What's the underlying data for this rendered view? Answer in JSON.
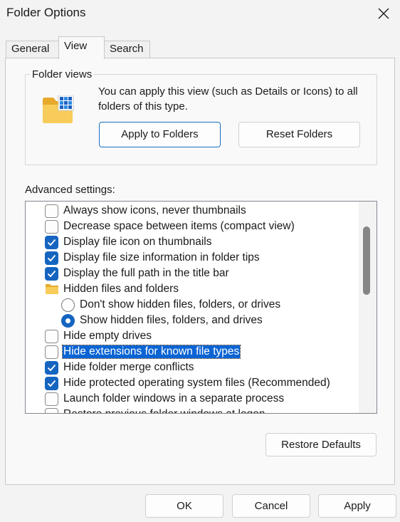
{
  "window": {
    "title": "Folder Options"
  },
  "tabs": [
    {
      "label": "General",
      "active": false
    },
    {
      "label": "View",
      "active": true
    },
    {
      "label": "Search",
      "active": false
    }
  ],
  "folder_views": {
    "legend": "Folder views",
    "description": "You can apply this view (such as Details or Icons) to all folders of this type.",
    "apply_button": "Apply to Folders",
    "reset_button": "Reset Folders"
  },
  "advanced": {
    "label": "Advanced settings:",
    "items": [
      {
        "type": "checkbox",
        "checked": false,
        "label": "Always show icons, never thumbnails"
      },
      {
        "type": "checkbox",
        "checked": false,
        "label": "Decrease space between items (compact view)"
      },
      {
        "type": "checkbox",
        "checked": true,
        "label": "Display file icon on thumbnails"
      },
      {
        "type": "checkbox",
        "checked": true,
        "label": "Display file size information in folder tips"
      },
      {
        "type": "checkbox",
        "checked": true,
        "label": "Display the full path in the title bar"
      },
      {
        "type": "folder",
        "label": "Hidden files and folders"
      },
      {
        "type": "radio",
        "checked": false,
        "label": "Don't show hidden files, folders, or drives"
      },
      {
        "type": "radio",
        "checked": true,
        "label": "Show hidden files, folders, and drives"
      },
      {
        "type": "checkbox",
        "checked": false,
        "label": "Hide empty drives"
      },
      {
        "type": "checkbox",
        "checked": false,
        "selected": true,
        "label": "Hide extensions for known file types"
      },
      {
        "type": "checkbox",
        "checked": true,
        "label": "Hide folder merge conflicts"
      },
      {
        "type": "checkbox",
        "checked": true,
        "label": "Hide protected operating system files (Recommended)"
      },
      {
        "type": "checkbox",
        "checked": false,
        "label": "Launch folder windows in a separate process"
      },
      {
        "type": "checkbox",
        "checked": false,
        "label": "Restore previous folder windows at logon"
      }
    ],
    "restore_button": "Restore Defaults"
  },
  "footer": {
    "ok": "OK",
    "cancel": "Cancel",
    "apply": "Apply"
  },
  "colors": {
    "accent": "#1565c0",
    "selection": "#0a64d4",
    "folder": "#f6c343"
  },
  "icons": [
    "close-icon",
    "folder-grid-icon",
    "folder-icon",
    "checkmark-icon"
  ]
}
